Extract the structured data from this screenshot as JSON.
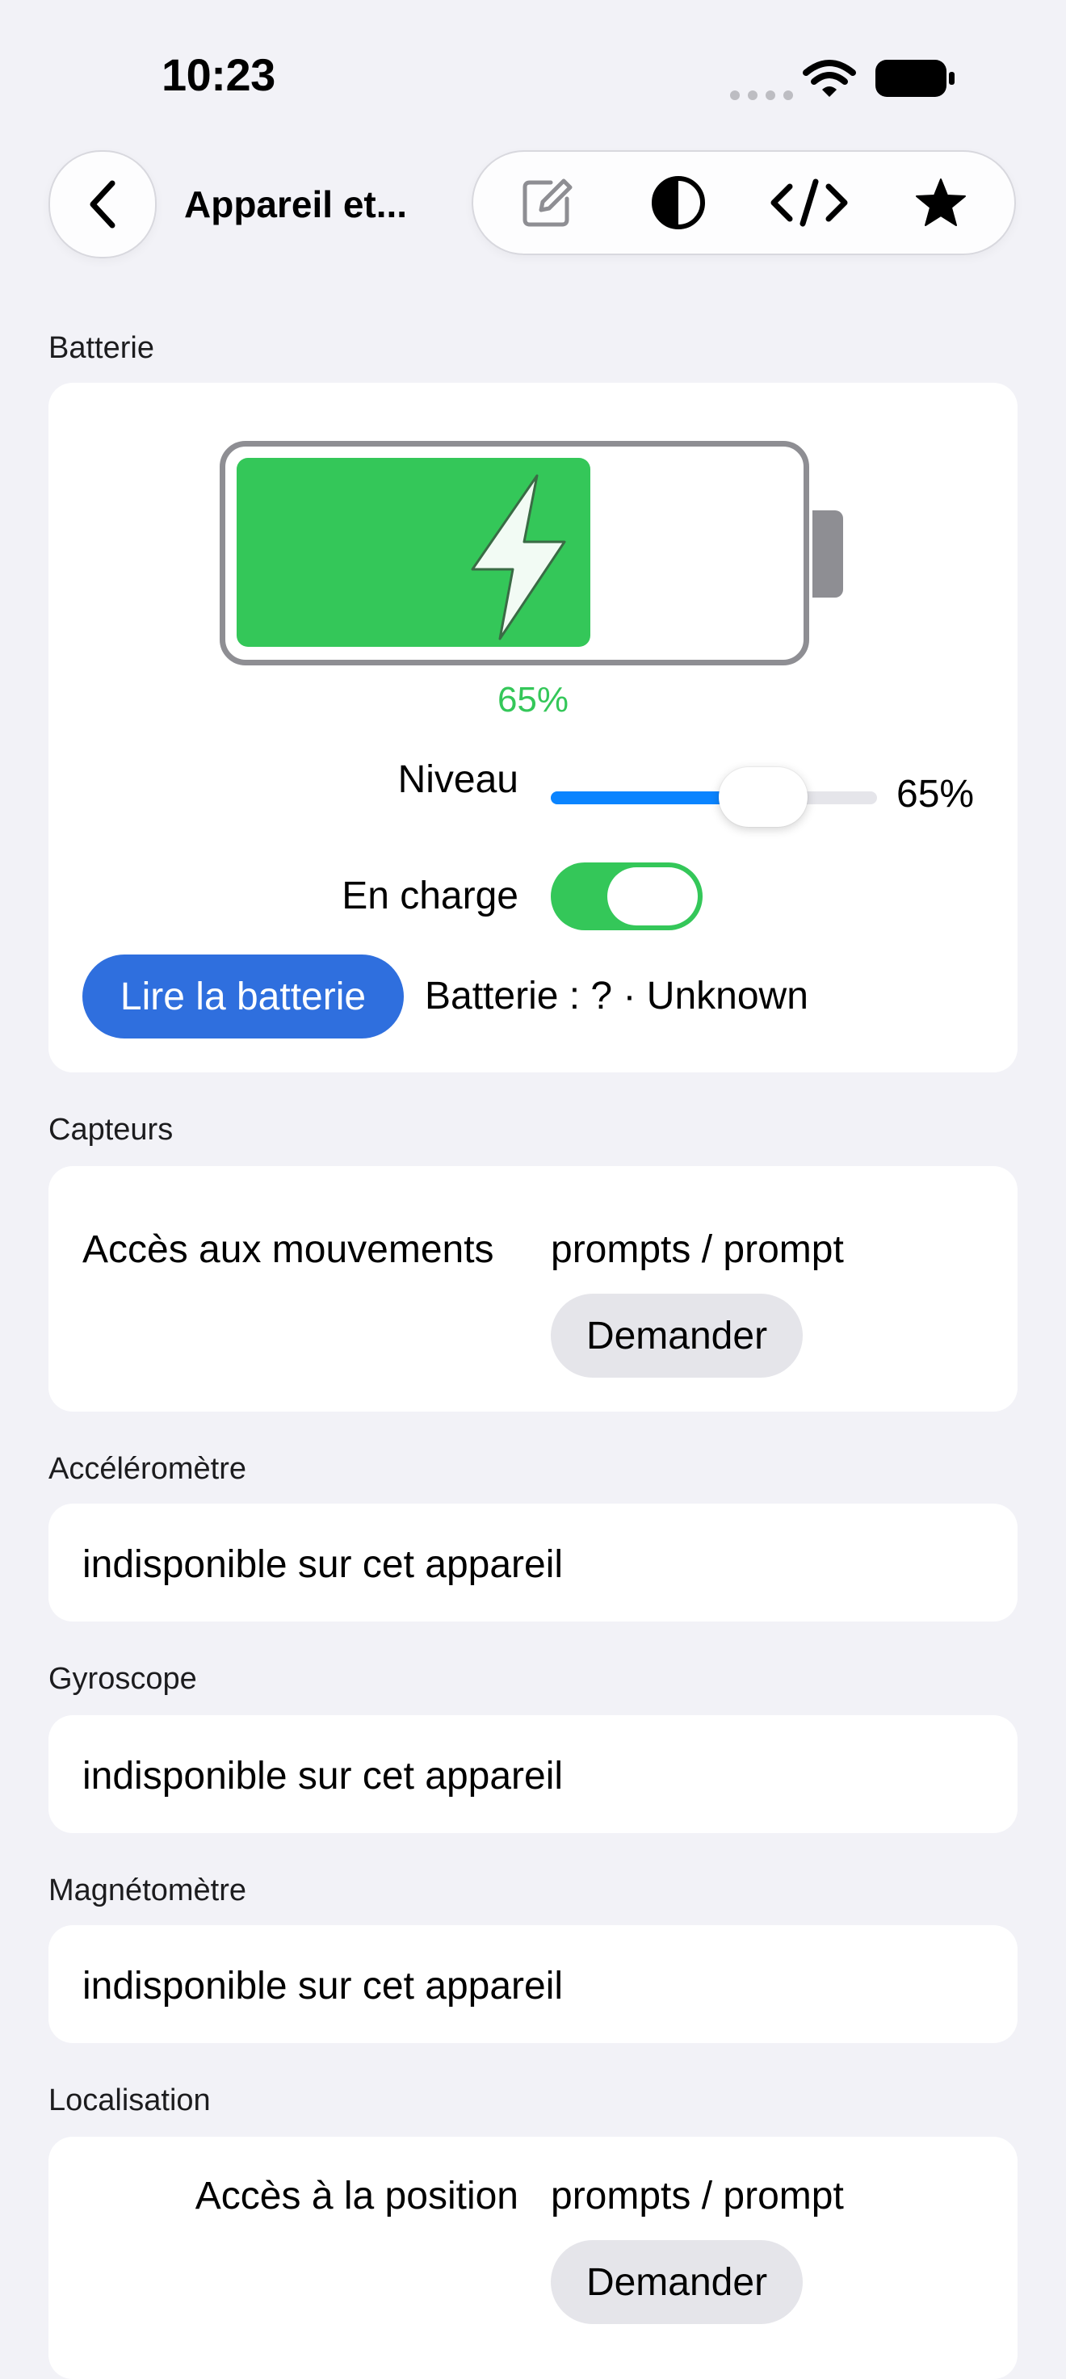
{
  "status_bar": {
    "time": "10:23"
  },
  "nav": {
    "title": "Appareil et...",
    "tools": [
      "edit-icon",
      "contrast-icon",
      "code-icon",
      "star-icon"
    ]
  },
  "battery": {
    "section": "Batterie",
    "percent_text": "65%",
    "level_fraction": 0.65,
    "level_label": "Niveau",
    "level_value": "65%",
    "charging_label": "En charge",
    "charging_on": true,
    "read_button": "Lire la batterie",
    "status": "Batterie : ? · Unknown"
  },
  "sensors": {
    "section": "Capteurs",
    "motion_label": "Accès aux mouvements",
    "motion_value": "prompts / prompt",
    "motion_button": "Demander"
  },
  "accelerometer": {
    "section": "Accéléromètre",
    "value": "indisponible sur cet appareil"
  },
  "gyroscope": {
    "section": "Gyroscope",
    "value": "indisponible sur cet appareil"
  },
  "magnetometer": {
    "section": "Magnétomètre",
    "value": "indisponible sur cet appareil"
  },
  "location": {
    "section": "Localisation",
    "label": "Accès à la position",
    "value": "prompts / prompt",
    "button": "Demander"
  },
  "colors": {
    "green": "#34c759",
    "blue_button": "#2f6fde",
    "slider_blue": "#0a84ff",
    "background": "#f2f2f7"
  }
}
